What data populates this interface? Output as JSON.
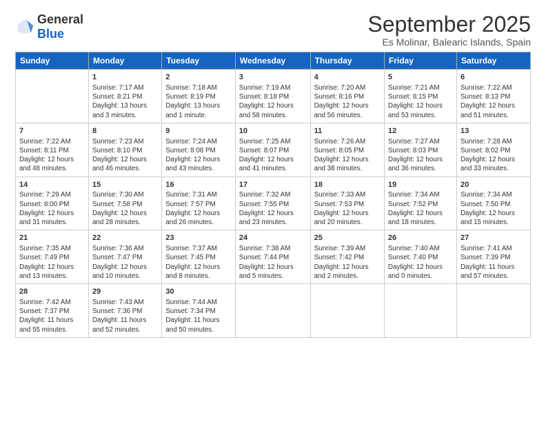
{
  "header": {
    "logo_general": "General",
    "logo_blue": "Blue",
    "title": "September 2025",
    "subtitle": "Es Molinar, Balearic Islands, Spain"
  },
  "days_of_week": [
    "Sunday",
    "Monday",
    "Tuesday",
    "Wednesday",
    "Thursday",
    "Friday",
    "Saturday"
  ],
  "weeks": [
    [
      {
        "day": "",
        "content": ""
      },
      {
        "day": "1",
        "content": "Sunrise: 7:17 AM\nSunset: 8:21 PM\nDaylight: 13 hours\nand 3 minutes."
      },
      {
        "day": "2",
        "content": "Sunrise: 7:18 AM\nSunset: 8:19 PM\nDaylight: 13 hours\nand 1 minute."
      },
      {
        "day": "3",
        "content": "Sunrise: 7:19 AM\nSunset: 8:18 PM\nDaylight: 12 hours\nand 58 minutes."
      },
      {
        "day": "4",
        "content": "Sunrise: 7:20 AM\nSunset: 8:16 PM\nDaylight: 12 hours\nand 56 minutes."
      },
      {
        "day": "5",
        "content": "Sunrise: 7:21 AM\nSunset: 8:15 PM\nDaylight: 12 hours\nand 53 minutes."
      },
      {
        "day": "6",
        "content": "Sunrise: 7:22 AM\nSunset: 8:13 PM\nDaylight: 12 hours\nand 51 minutes."
      }
    ],
    [
      {
        "day": "7",
        "content": "Sunrise: 7:22 AM\nSunset: 8:11 PM\nDaylight: 12 hours\nand 48 minutes."
      },
      {
        "day": "8",
        "content": "Sunrise: 7:23 AM\nSunset: 8:10 PM\nDaylight: 12 hours\nand 46 minutes."
      },
      {
        "day": "9",
        "content": "Sunrise: 7:24 AM\nSunset: 8:08 PM\nDaylight: 12 hours\nand 43 minutes."
      },
      {
        "day": "10",
        "content": "Sunrise: 7:25 AM\nSunset: 8:07 PM\nDaylight: 12 hours\nand 41 minutes."
      },
      {
        "day": "11",
        "content": "Sunrise: 7:26 AM\nSunset: 8:05 PM\nDaylight: 12 hours\nand 38 minutes."
      },
      {
        "day": "12",
        "content": "Sunrise: 7:27 AM\nSunset: 8:03 PM\nDaylight: 12 hours\nand 36 minutes."
      },
      {
        "day": "13",
        "content": "Sunrise: 7:28 AM\nSunset: 8:02 PM\nDaylight: 12 hours\nand 33 minutes."
      }
    ],
    [
      {
        "day": "14",
        "content": "Sunrise: 7:29 AM\nSunset: 8:00 PM\nDaylight: 12 hours\nand 31 minutes."
      },
      {
        "day": "15",
        "content": "Sunrise: 7:30 AM\nSunset: 7:58 PM\nDaylight: 12 hours\nand 28 minutes."
      },
      {
        "day": "16",
        "content": "Sunrise: 7:31 AM\nSunset: 7:57 PM\nDaylight: 12 hours\nand 26 minutes."
      },
      {
        "day": "17",
        "content": "Sunrise: 7:32 AM\nSunset: 7:55 PM\nDaylight: 12 hours\nand 23 minutes."
      },
      {
        "day": "18",
        "content": "Sunrise: 7:33 AM\nSunset: 7:53 PM\nDaylight: 12 hours\nand 20 minutes."
      },
      {
        "day": "19",
        "content": "Sunrise: 7:34 AM\nSunset: 7:52 PM\nDaylight: 12 hours\nand 18 minutes."
      },
      {
        "day": "20",
        "content": "Sunrise: 7:34 AM\nSunset: 7:50 PM\nDaylight: 12 hours\nand 15 minutes."
      }
    ],
    [
      {
        "day": "21",
        "content": "Sunrise: 7:35 AM\nSunset: 7:49 PM\nDaylight: 12 hours\nand 13 minutes."
      },
      {
        "day": "22",
        "content": "Sunrise: 7:36 AM\nSunset: 7:47 PM\nDaylight: 12 hours\nand 10 minutes."
      },
      {
        "day": "23",
        "content": "Sunrise: 7:37 AM\nSunset: 7:45 PM\nDaylight: 12 hours\nand 8 minutes."
      },
      {
        "day": "24",
        "content": "Sunrise: 7:38 AM\nSunset: 7:44 PM\nDaylight: 12 hours\nand 5 minutes."
      },
      {
        "day": "25",
        "content": "Sunrise: 7:39 AM\nSunset: 7:42 PM\nDaylight: 12 hours\nand 2 minutes."
      },
      {
        "day": "26",
        "content": "Sunrise: 7:40 AM\nSunset: 7:40 PM\nDaylight: 12 hours\nand 0 minutes."
      },
      {
        "day": "27",
        "content": "Sunrise: 7:41 AM\nSunset: 7:39 PM\nDaylight: 11 hours\nand 57 minutes."
      }
    ],
    [
      {
        "day": "28",
        "content": "Sunrise: 7:42 AM\nSunset: 7:37 PM\nDaylight: 11 hours\nand 55 minutes."
      },
      {
        "day": "29",
        "content": "Sunrise: 7:43 AM\nSunset: 7:36 PM\nDaylight: 11 hours\nand 52 minutes."
      },
      {
        "day": "30",
        "content": "Sunrise: 7:44 AM\nSunset: 7:34 PM\nDaylight: 11 hours\nand 50 minutes."
      },
      {
        "day": "",
        "content": ""
      },
      {
        "day": "",
        "content": ""
      },
      {
        "day": "",
        "content": ""
      },
      {
        "day": "",
        "content": ""
      }
    ]
  ]
}
